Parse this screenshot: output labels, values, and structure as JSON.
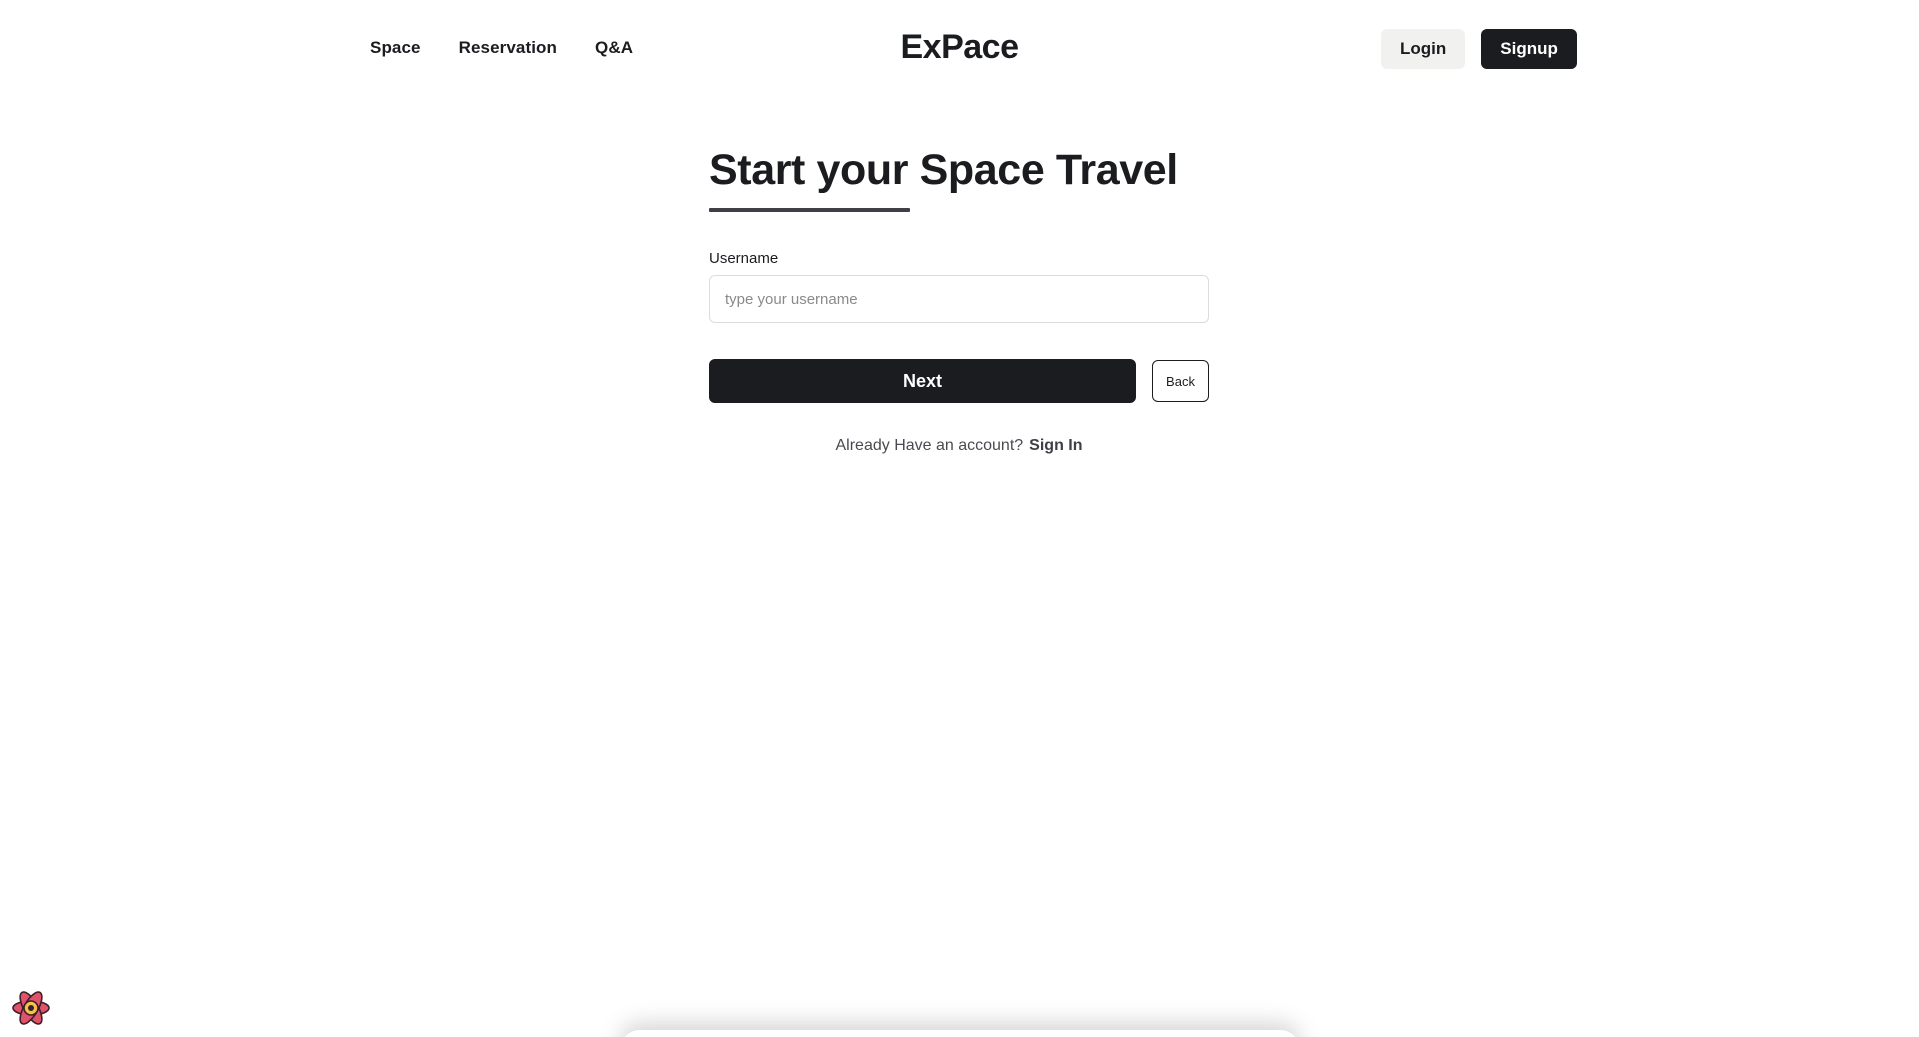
{
  "header": {
    "nav": [
      "Space",
      "Reservation",
      "Q&A"
    ],
    "brand": "ExPace",
    "login_label": "Login",
    "signup_label": "Signup"
  },
  "form": {
    "title": "Start your Space Travel",
    "username_label": "Username",
    "username_placeholder": "type your username",
    "username_value": "",
    "next_label": "Next",
    "back_label": "Back",
    "account_prompt": "Already Have an account?",
    "signin_label": "Sign In"
  },
  "icons": {
    "corner": "react-devtools-icon"
  },
  "colors": {
    "primary": "#1b1c20",
    "secondary_bg": "#f1f1f0",
    "underline": "#3f4046",
    "icon_fill": "#e0526b"
  }
}
